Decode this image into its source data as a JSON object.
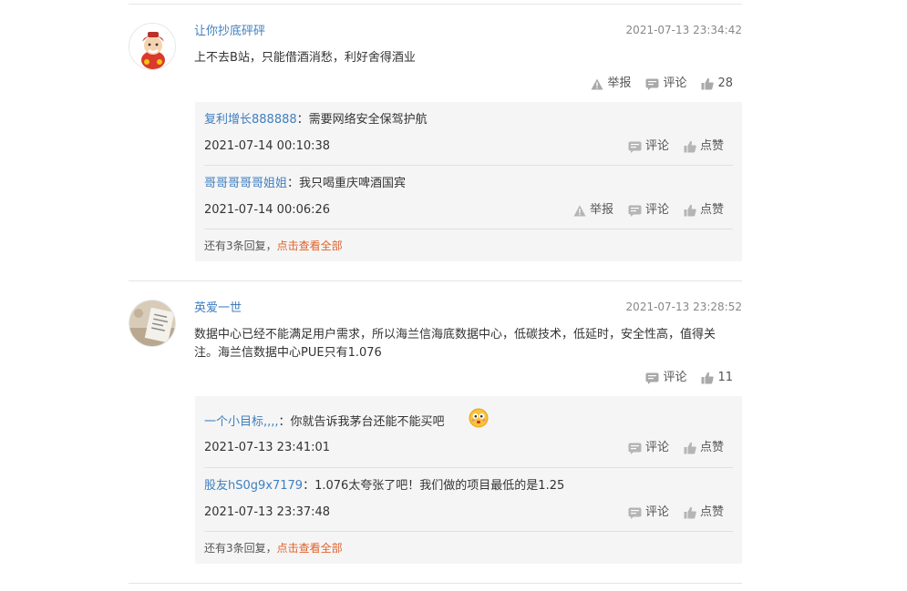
{
  "comments": [
    {
      "username": "让你抄底砰砰",
      "time": "2021-07-13 23:34:42",
      "text": "上不去B站，只能借酒消愁，利好舍得酒业",
      "report_label": "举报",
      "comment_label": "评论",
      "like_count": "28",
      "replies": [
        {
          "username": "复利增长888888",
          "sep": "：",
          "text": "需要网络安全保驾护航",
          "time": "2021-07-14 00:10:38",
          "comment_label": "评论",
          "like_label": "点赞"
        },
        {
          "username": "哥哥哥哥哥姐姐",
          "sep": "：",
          "text": "我只喝重庆啤酒国宾",
          "time": "2021-07-14 00:06:26",
          "report_label": "举报",
          "comment_label": "评论",
          "like_label": "点赞"
        }
      ],
      "more_text": "还有3条回复，",
      "more_link": "点击查看全部"
    },
    {
      "username": "英爱一世",
      "time": "2021-07-13 23:28:52",
      "text": "数据中心已经不能满足用户需求，所以海兰信海底数据中心，低碳技术，低延时，安全性高，值得关注。海兰信数据中心PUE只有1.076",
      "comment_label": "评论",
      "like_count": "11",
      "replies": [
        {
          "username": "一个小目标,,,,",
          "sep": "：",
          "text": "你就告诉我茅台还能不能买吧",
          "time": "2021-07-13 23:41:01",
          "comment_label": "评论",
          "like_label": "点赞"
        },
        {
          "username": "股友hS0g9x7179",
          "sep": "：",
          "text": "1.076太夸张了吧！我们做的项目最低的是1.25",
          "time": "2021-07-13 23:37:48",
          "comment_label": "评论",
          "like_label": "点赞"
        }
      ],
      "more_text": "还有3条回复，",
      "more_link": "点击查看全部"
    }
  ],
  "icons": {
    "report": "warning-triangle-icon",
    "comment": "speech-bubble-icon",
    "like": "thumbs-up-icon"
  },
  "colors": {
    "username": "#3f7fbf",
    "more_link": "#e0622a",
    "reply_bg": "#f5f5f5"
  }
}
